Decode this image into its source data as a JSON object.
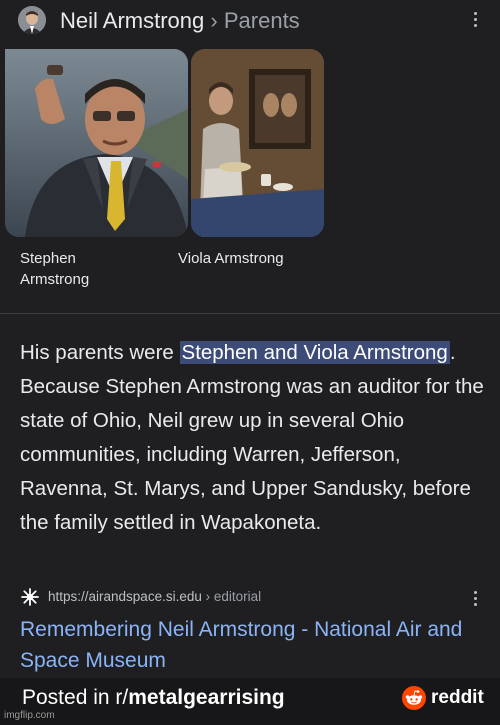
{
  "header": {
    "title": "Neil Armstrong",
    "separator": "›",
    "subtitle": "Parents"
  },
  "cards": [
    {
      "name": "Stephen Armstrong"
    },
    {
      "name": "Viola Armstrong"
    }
  ],
  "answer": {
    "before": "His parents were ",
    "highlight": "Stephen and Viola Armstrong",
    "after": ". Because Stephen Armstrong was an auditor for the state of Ohio, Neil grew up in several Ohio communities, including Warren, Jefferson, Ravenna, St. Marys, and Upper Sandusky, before the family settled in Wapakoneta."
  },
  "source": {
    "url": "https://airandspace.si.edu",
    "crumb": " › editorial",
    "title": "Remembering Neil Armstrong - National Air and Space Museum"
  },
  "watermark": {
    "posted_prefix": "Posted in r/",
    "subreddit": "metalgearrising",
    "reddit_word": "reddit",
    "imgflip": "imgflip.com"
  },
  "colors": {
    "background": "#1f1f21",
    "link": "#8ab4f8",
    "highlight": "#3c4b78",
    "reddit_orange": "#ff4500"
  }
}
